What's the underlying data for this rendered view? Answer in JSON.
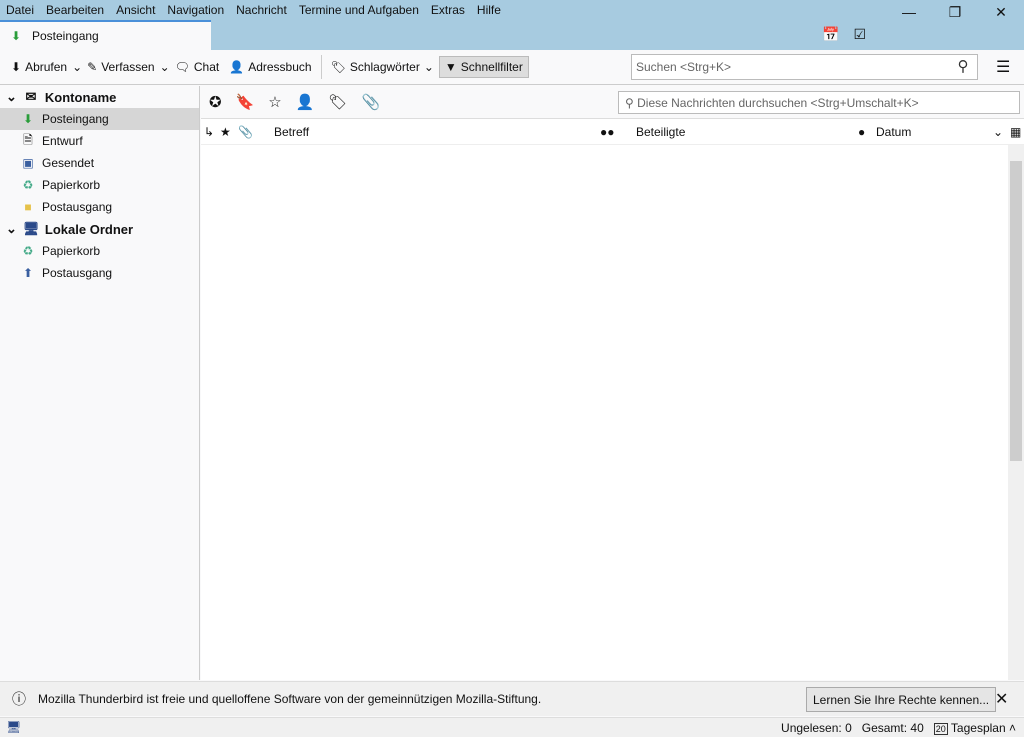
{
  "menu": [
    "Datei",
    "Bearbeiten",
    "Ansicht",
    "Navigation",
    "Nachricht",
    "Termine und Aufgaben",
    "Extras",
    "Hilfe"
  ],
  "tab": {
    "label": "Posteingang"
  },
  "toolbar": {
    "get": "Abrufen",
    "write": "Verfassen",
    "chat": "Chat",
    "addressbook": "Adressbuch",
    "tags": "Schlagwörter",
    "quickfilter": "Schnellfilter",
    "search_placeholder": "Suchen <Strg+K>"
  },
  "folders": {
    "account": "Kontoname",
    "items": [
      "Posteingang",
      "Entwurf",
      "Gesendet",
      "Papierkorb",
      "Postausgang"
    ],
    "local": "Lokale Ordner",
    "local_items": [
      "Papierkorb",
      "Postausgang"
    ]
  },
  "quickfilter": {
    "search_placeholder": "Diese Nachrichten durchsuchen <Strg+Umschalt+K>"
  },
  "columns": {
    "subject": "Betreff",
    "correspondents": "Beteiligte",
    "date": "Datum"
  },
  "notification": {
    "text": "Mozilla Thunderbird ist freie und quelloffene Software von der gemeinnützigen Mozilla-Stiftung.",
    "button": "Lernen Sie Ihre Rechte kennen..."
  },
  "status": {
    "unread": "Ungelesen: 0",
    "total": "Gesamt: 40",
    "today": "Tagesplan",
    "today_day": "20"
  }
}
